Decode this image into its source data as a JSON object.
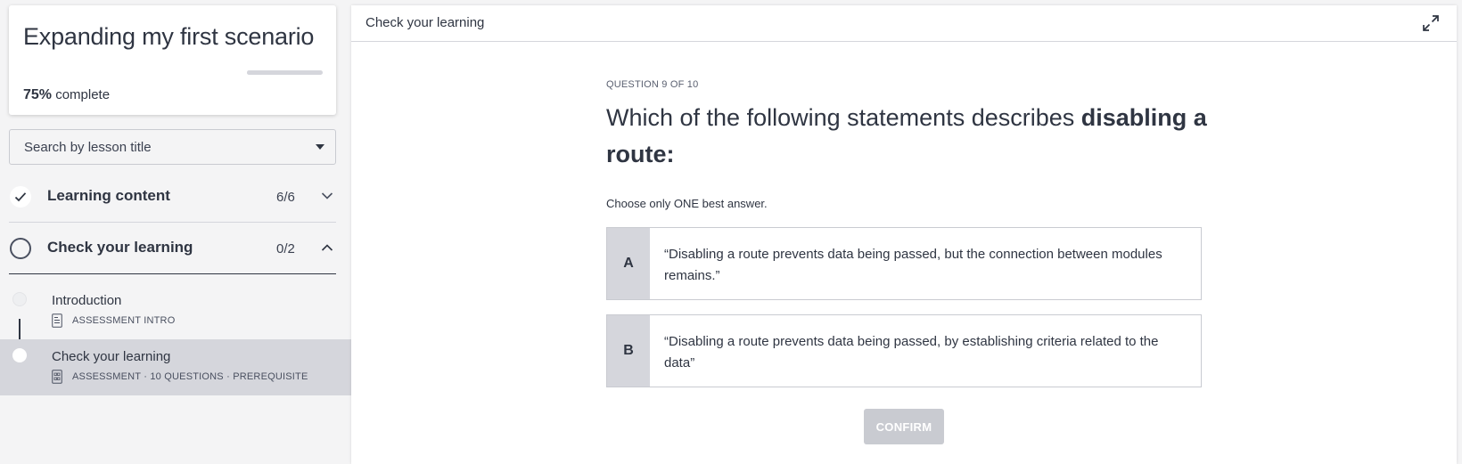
{
  "course": {
    "title": "Expanding my first scenario",
    "progress_percent": 75,
    "progress_pct_label": "75%",
    "progress_suffix": " complete"
  },
  "search": {
    "placeholder": "Search by lesson title"
  },
  "sections": [
    {
      "title": "Learning content",
      "count": "6/6",
      "status": "complete",
      "expanded": false
    },
    {
      "title": "Check your learning",
      "count": "0/2",
      "status": "incomplete",
      "expanded": true
    }
  ],
  "lessons": [
    {
      "title": "Introduction",
      "meta": "ASSESSMENT INTRO",
      "icon": "document-icon",
      "active": false
    },
    {
      "title": "Check your learning",
      "meta": "ASSESSMENT · 10 QUESTIONS · PREREQUISITE",
      "icon": "assessment-icon",
      "active": true
    }
  ],
  "main": {
    "header_title": "Check your learning",
    "question_counter": "QUESTION 9 OF 10",
    "question_prefix": "Which of the following statements describes ",
    "question_bold": "disabling a route",
    "question_suffix": ":",
    "instruction": "Choose only ONE best answer.",
    "options": [
      {
        "letter": "A",
        "text": "“Disabling a route prevents data being passed, but the connection between modules remains.”"
      },
      {
        "letter": "B",
        "text": "“Disabling a route prevents data being passed, by establishing criteria related to the data”"
      }
    ],
    "confirm_label": "CONFIRM"
  },
  "colors": {
    "text": "#2f3542",
    "muted_fill": "#d5d6dc",
    "button_disabled": "#c9cbd1",
    "background": "#f4f4f5"
  }
}
